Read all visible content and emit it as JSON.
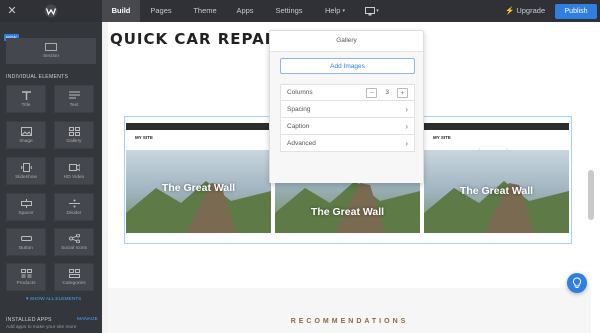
{
  "topbar": {
    "tabs": [
      "Build",
      "Pages",
      "Theme",
      "Apps",
      "Settings",
      "Help"
    ],
    "upgrade": "Upgrade",
    "publish": "Publish"
  },
  "sidebar": {
    "badge": "NEW",
    "section_label": "Section",
    "elements_heading": "INDIVIDUAL ELEMENTS",
    "tiles": [
      "Title",
      "Text",
      "Image",
      "Gallery",
      "Slideshow",
      "HD Video",
      "Spacer",
      "Divider",
      "Button",
      "Social Icons",
      "Products",
      "Categories"
    ],
    "show_all": "SHOW ALL ELEMENTS",
    "installed_heading": "INSTALLED APPS",
    "manage": "MANAGE",
    "apps_desc": "Add apps to make your site more"
  },
  "page": {
    "site_title": "QUICK CAR REPAIRS",
    "gallery_caption": "The Great Wall",
    "gallery_site_name": "MY SITE",
    "recommendations": "RECOMMENDATIONS"
  },
  "popover": {
    "title": "Gallery",
    "add_images": "Add Images",
    "columns_label": "Columns",
    "columns_value": "3",
    "rows": [
      "Spacing",
      "Caption",
      "Advanced"
    ]
  },
  "colors": {
    "accent": "#2f7fe0",
    "topbar": "#2f3136",
    "sidebar": "#33363b"
  }
}
